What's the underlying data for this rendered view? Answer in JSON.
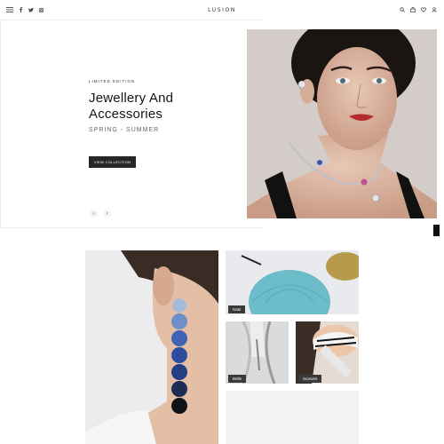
{
  "header": {
    "logo": "LUSION",
    "social_icons": [
      "facebook-icon",
      "twitter-icon",
      "instagram-icon"
    ],
    "action_icons": [
      "search-icon",
      "cart-icon",
      "wishlist-icon",
      "user-icon"
    ]
  },
  "hero": {
    "eyebrow": "LIMITED EDITION",
    "title_line1": "Jewellery And",
    "title_line2": "Accessories",
    "subtitle": "SPRING - SUMMER",
    "cta_label": "VIEW COLLECTION",
    "prev_arrow": "‹",
    "next_arrow": "›"
  },
  "categories": {
    "hats": "Hats",
    "belts": "Belts",
    "scarves": "Scarves"
  },
  "colors": {
    "accent_dark": "#262626",
    "tag_bg": "#3a3a3a"
  }
}
